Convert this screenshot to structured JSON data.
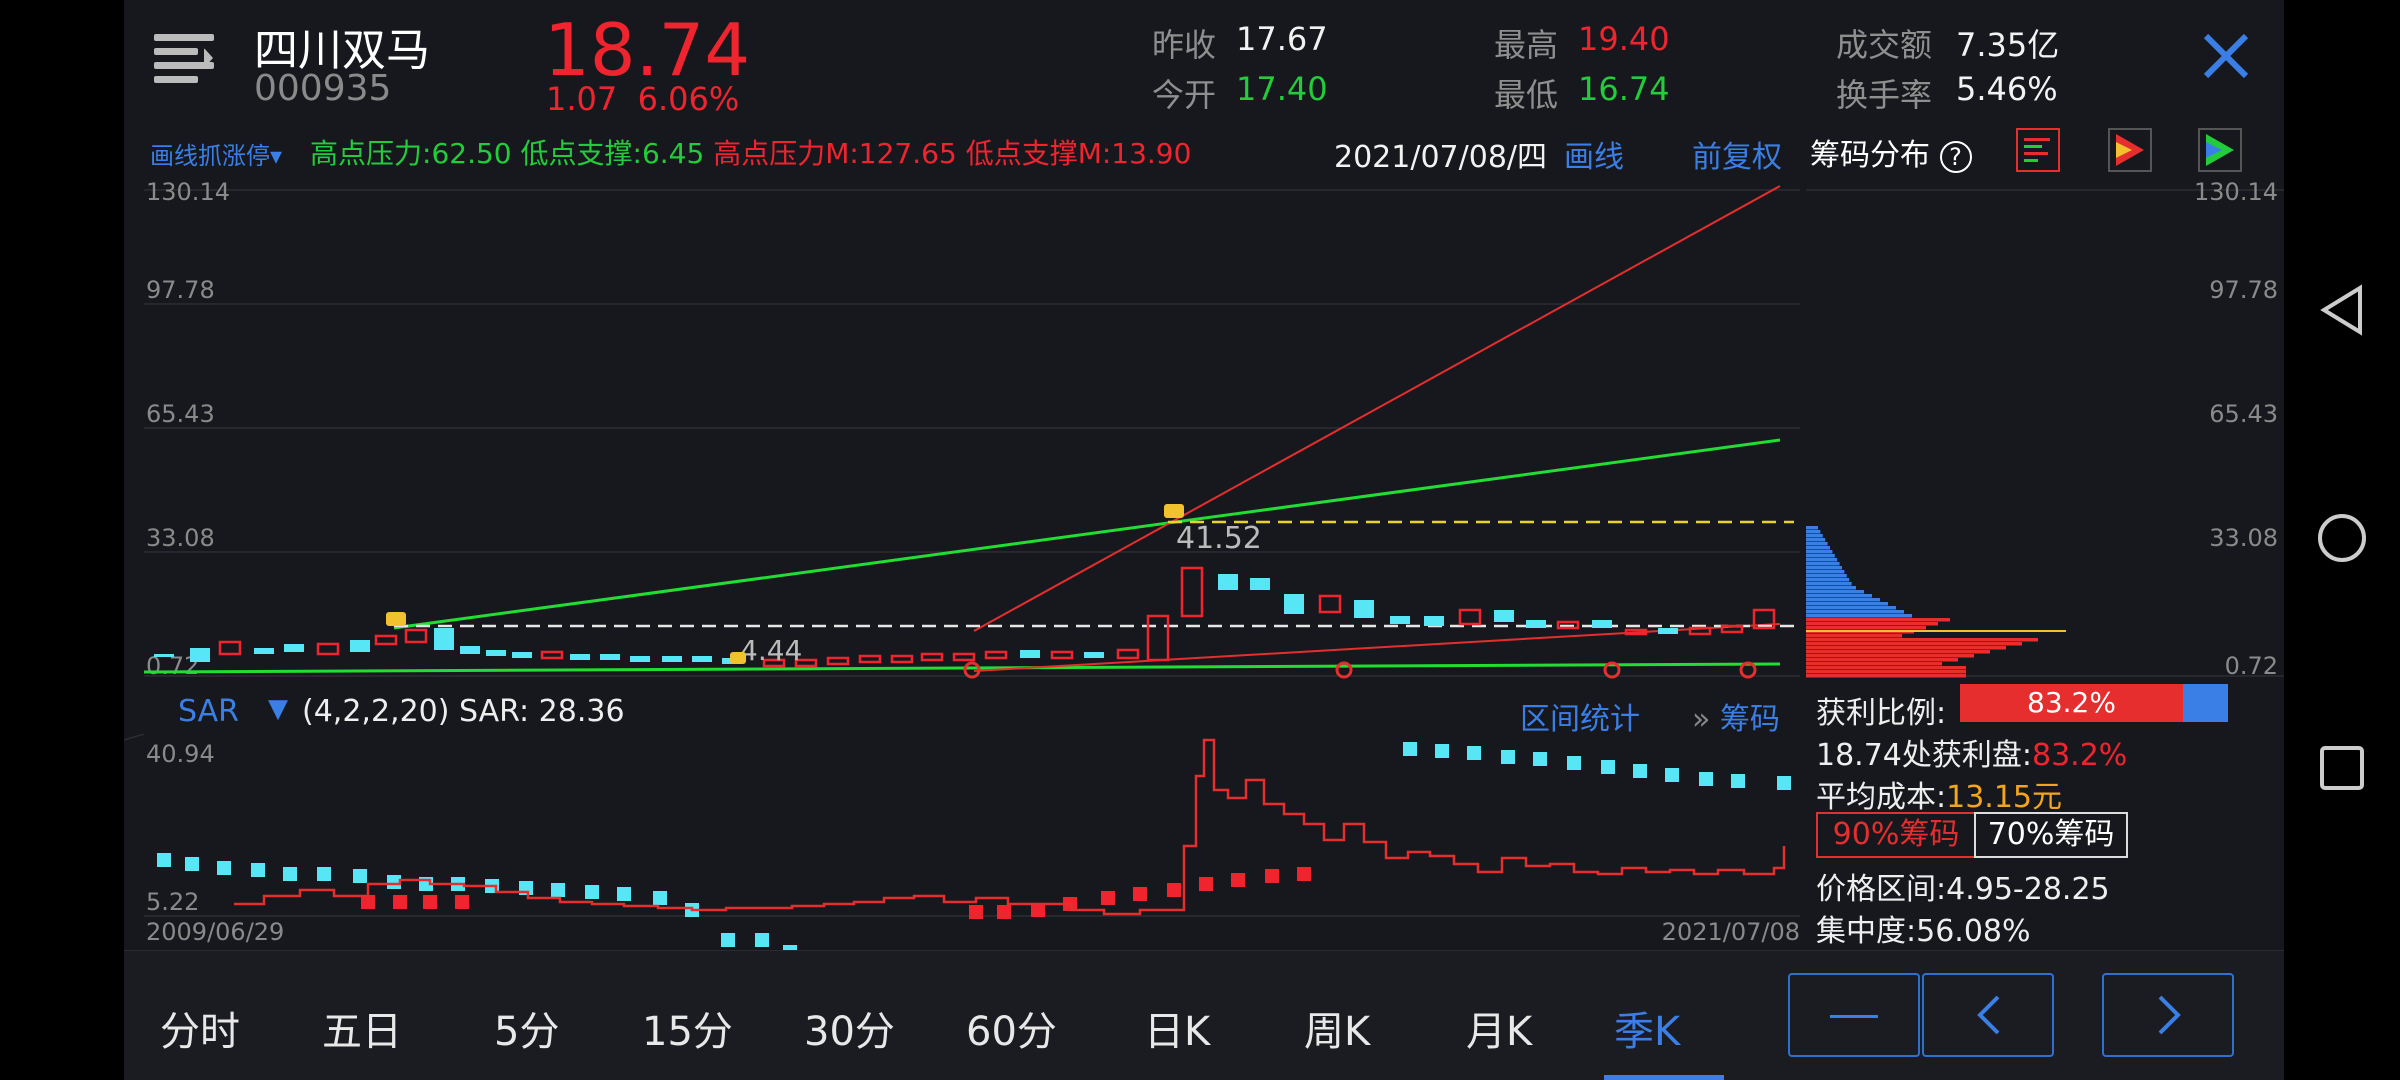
{
  "stock": {
    "name": "四川双马",
    "code": "000935",
    "price": "18.74",
    "change": "1.07",
    "change_pct": "6.06%"
  },
  "quote": {
    "prev_close_label": "昨收",
    "prev_close": "17.67",
    "open_label": "今开",
    "open": "17.40",
    "high_label": "最高",
    "high": "19.40",
    "low_label": "最低",
    "low": "16.74",
    "turnover_amt_label": "成交额",
    "turnover_amt": "7.35亿",
    "turnover_rate_label": "换手率",
    "turnover_rate": "5.46%"
  },
  "toolbar": {
    "draw_limit": "画线抓涨停▾",
    "high_pressure": "高点压力:",
    "high_pressure_val": "62.50",
    "low_support": "低点支撑:",
    "low_support_val": "6.45",
    "high_pressure_m": "高点压力M:",
    "high_pressure_m_val": "127.65",
    "low_support_m": "低点支撑M:",
    "low_support_m_val": "13.90",
    "date": "2021/07/08/四",
    "draw_line": "画线",
    "adjust": "前复权"
  },
  "main_chart": {
    "y_ticks": [
      "130.14",
      "97.78",
      "65.43",
      "33.08",
      "0.72"
    ],
    "annotation_high": "41.52",
    "annotation_low": "4.44"
  },
  "indicator": {
    "name": "SAR",
    "arrow": "▼",
    "params": "(4,2,2,20) SAR: 28.36",
    "range_stats": "区间统计",
    "chips": "筹码",
    "chips_prefix": "»",
    "y_top": "40.94",
    "y_bottom": "5.22",
    "date_start": "2009/06/29",
    "date_end": "2021/07/08"
  },
  "chip_panel": {
    "title": "筹码分布",
    "help": "?",
    "y_ticks": [
      "130.14",
      "97.78",
      "65.43",
      "33.08",
      "0.72"
    ],
    "profit_ratio_label": "获利比例:",
    "profit_ratio": "83.2%",
    "profit_ratio_value": 0.832,
    "profit_at_label": "18.74处获利盘:",
    "profit_at": "83.2%",
    "avg_cost_label": "平均成本:",
    "avg_cost": "13.15元",
    "chip90": "90%筹码",
    "chip70": "70%筹码",
    "price_range_label": "价格区间:",
    "price_range": "4.95-28.25",
    "concentration_label": "集中度:",
    "concentration": "56.08%"
  },
  "tabs": [
    "分时",
    "五日",
    "5分",
    "15分",
    "30分",
    "60分",
    "日K",
    "周K",
    "月K",
    "季K"
  ],
  "active_tab": "季K",
  "colors": {
    "up": "#f0242f",
    "down": "#56e6f5",
    "accent": "#3a7fe6",
    "green": "#22cc3a"
  }
}
